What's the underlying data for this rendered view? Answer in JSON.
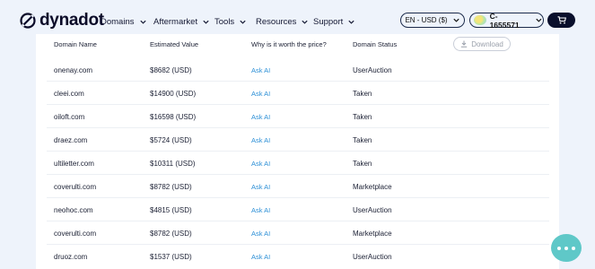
{
  "brand": {
    "name": "dynadot"
  },
  "nav": [
    {
      "label": "Domains"
    },
    {
      "label": "Aftermarket"
    },
    {
      "label": "Tools"
    },
    {
      "label": "Resources"
    },
    {
      "label": "Support"
    }
  ],
  "language": {
    "label": "EN - USD ($)"
  },
  "account": {
    "label": "C-1655571"
  },
  "table": {
    "headers": {
      "domain": "Domain Name",
      "value": "Estimated Value",
      "why": "Why is it worth the price?",
      "status": "Domain Status"
    },
    "download_label": "Download",
    "rows": [
      {
        "domain": "onenay.com",
        "value": "$8682 (USD)",
        "ask": "Ask AI",
        "status": "UserAuction"
      },
      {
        "domain": "cleei.com",
        "value": "$14900 (USD)",
        "ask": "Ask AI",
        "status": "Taken"
      },
      {
        "domain": "oiloft.com",
        "value": "$16598 (USD)",
        "ask": "Ask AI",
        "status": "Taken"
      },
      {
        "domain": "draez.com",
        "value": "$5724 (USD)",
        "ask": "Ask AI",
        "status": "Taken"
      },
      {
        "domain": "ultiletter.com",
        "value": "$10311 (USD)",
        "ask": "Ask AI",
        "status": "Taken"
      },
      {
        "domain": "coverulti.com",
        "value": "$8782 (USD)",
        "ask": "Ask AI",
        "status": "Marketplace"
      },
      {
        "domain": "neohoc.com",
        "value": "$4815 (USD)",
        "ask": "Ask AI",
        "status": "UserAuction"
      },
      {
        "domain": "coverulti.com",
        "value": "$8782 (USD)",
        "ask": "Ask AI",
        "status": "Marketplace"
      },
      {
        "domain": "druoz.com",
        "value": "$1537 (USD)",
        "ask": "Ask AI",
        "status": "UserAuction"
      }
    ]
  },
  "colors": {
    "link": "#2b8fd6",
    "header_bg": "#eef3fb",
    "cart_bg": "#0a0f2c",
    "chat_bg": "#5fc8c8"
  }
}
